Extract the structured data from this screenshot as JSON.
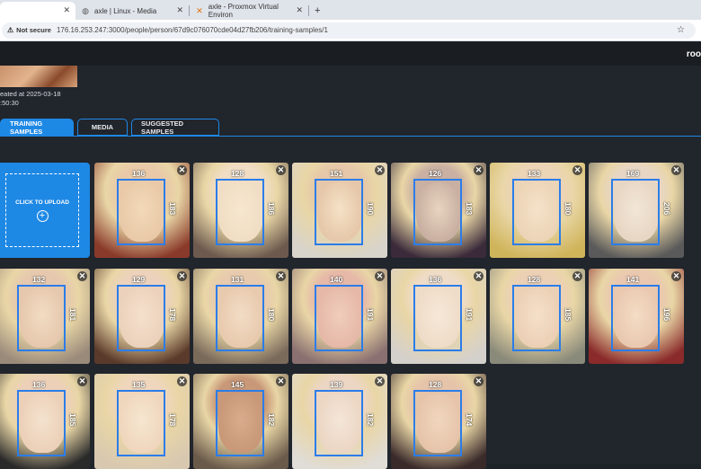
{
  "browser": {
    "tabs": [
      {
        "title": "",
        "active": true,
        "icon": "blank-icon"
      },
      {
        "title": "axle | Linux - Media",
        "active": false,
        "icon": "globe-icon"
      },
      {
        "title": "axle - Proxmox Virtual Environ",
        "active": false,
        "icon": "proxmox-icon"
      }
    ],
    "new_tab": "+",
    "security": "Not secure",
    "url": "176.16.253.247:3000/people/person/67d9c076070cde04d27fb206/training-samples/1"
  },
  "app": {
    "user": "roo",
    "created_line1": "eated at 2025-03-18",
    "created_line2": ":50:30",
    "tabs": [
      "TRAINING SAMPLES",
      "MEDIA",
      "SUGGESTED SAMPLES"
    ],
    "upload_label": "CLICK TO UPLOAD",
    "upload_icon": "+"
  },
  "samples": [
    {
      "w": "136",
      "h": "183"
    },
    {
      "w": "128",
      "h": "186"
    },
    {
      "w": "151",
      "h": "190"
    },
    {
      "w": "126",
      "h": "183"
    },
    {
      "w": "133",
      "h": "180"
    },
    {
      "w": "169",
      "h": "206"
    },
    {
      "w": "132",
      "h": "181"
    },
    {
      "w": "129",
      "h": "178"
    },
    {
      "w": "131",
      "h": "180"
    },
    {
      "w": "140",
      "h": "191"
    },
    {
      "w": "136",
      "h": "191"
    },
    {
      "w": "128",
      "h": "185"
    },
    {
      "w": "141",
      "h": "196"
    },
    {
      "w": "136",
      "h": "185"
    },
    {
      "w": "135",
      "h": "178"
    },
    {
      "w": "145",
      "h": "182"
    },
    {
      "w": "139",
      "h": "182"
    },
    {
      "w": "128",
      "h": "174"
    }
  ],
  "close_glyph": "✕"
}
